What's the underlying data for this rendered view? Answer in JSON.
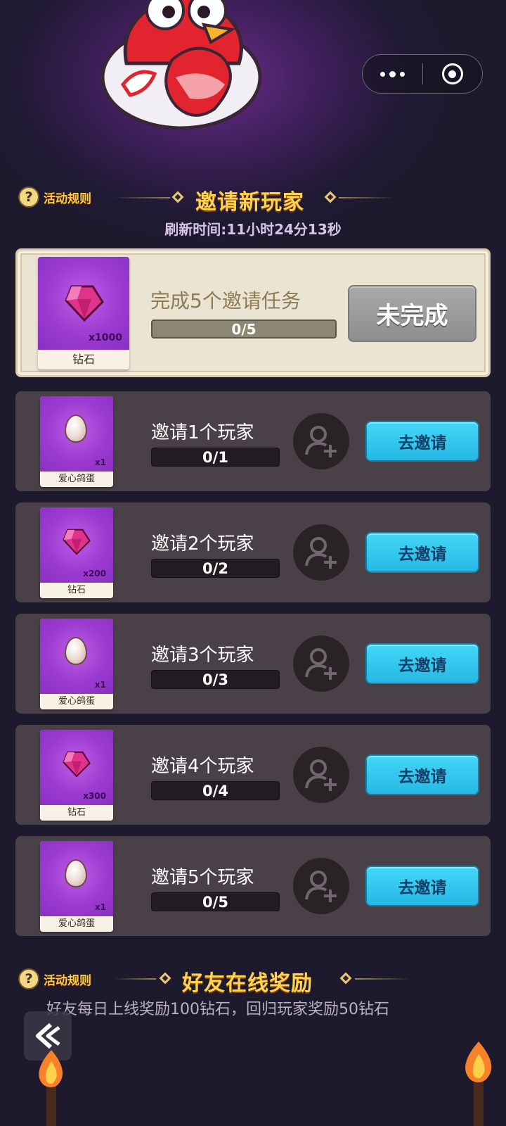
{
  "capsule": {
    "more_icon": "more-dots-icon",
    "close_icon": "target-close-icon"
  },
  "section1": {
    "rules_label": "活动规则",
    "title": "邀请新玩家",
    "refresh": "刷新时间:11小时24分13秒"
  },
  "main_task": {
    "reward_qty": "x1000",
    "reward_name": "钻石",
    "title": "完成5个邀请任务",
    "progress_text": "0/5",
    "progress": 0,
    "status_button": "未完成"
  },
  "tasks": [
    {
      "title": "邀请1个玩家",
      "progress_text": "0/1",
      "progress": 0,
      "reward_qty": "x1",
      "reward_name": "爱心鸽蛋",
      "reward_icon": "egg-icon",
      "button": "去邀请"
    },
    {
      "title": "邀请2个玩家",
      "progress_text": "0/2",
      "progress": 0,
      "reward_qty": "x200",
      "reward_name": "钻石",
      "reward_icon": "gem-icon",
      "button": "去邀请"
    },
    {
      "title": "邀请3个玩家",
      "progress_text": "0/3",
      "progress": 0,
      "reward_qty": "x1",
      "reward_name": "爱心鸽蛋",
      "reward_icon": "egg-icon",
      "button": "去邀请"
    },
    {
      "title": "邀请4个玩家",
      "progress_text": "0/4",
      "progress": 0,
      "reward_qty": "x300",
      "reward_name": "钻石",
      "reward_icon": "gem-icon",
      "button": "去邀请"
    },
    {
      "title": "邀请5个玩家",
      "progress_text": "0/5",
      "progress": 0,
      "reward_qty": "x1",
      "reward_name": "爱心鸽蛋",
      "reward_icon": "egg-icon",
      "button": "去邀请"
    }
  ],
  "section2": {
    "rules_label": "活动规则",
    "title": "好友在线奖励",
    "description": "好友每日上线奖励100钻石，回归玩家奖励50钻石"
  },
  "colors": {
    "accent_gold": "#ffd34a",
    "invite_button": "#2cc3ee",
    "gem": "#e0338c"
  }
}
